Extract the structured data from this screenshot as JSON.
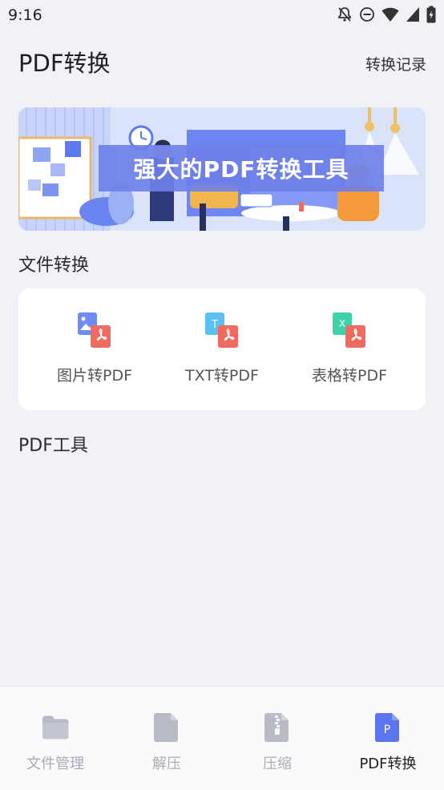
{
  "status_bar": {
    "time": "9:16",
    "icons": [
      "notifications-off-icon",
      "do-not-disturb-icon",
      "wifi-icon",
      "signal-icon",
      "battery-icon"
    ]
  },
  "header": {
    "title": "PDF转换",
    "action_label": "转换记录"
  },
  "banner": {
    "text": "强大的PDF转换工具"
  },
  "file_conversion": {
    "section_title": "文件转换",
    "tools": [
      {
        "label": "图片转PDF",
        "icon": "image-to-pdf-icon",
        "badge_color": "#6f8cf2"
      },
      {
        "label": "TXT转PDF",
        "icon": "txt-to-pdf-icon",
        "badge_color": "#5cc0f2"
      },
      {
        "label": "表格转PDF",
        "icon": "excel-to-pdf-icon",
        "badge_color": "#3fd1a8"
      }
    ]
  },
  "pdf_tools": {
    "section_title": "PDF工具"
  },
  "tabbar": {
    "items": [
      {
        "label": "文件管理",
        "icon": "folder-icon",
        "active": false
      },
      {
        "label": "解压",
        "icon": "document-icon",
        "active": false
      },
      {
        "label": "压缩",
        "icon": "zip-file-icon",
        "active": false
      },
      {
        "label": "PDF转换",
        "icon": "pdf-file-icon",
        "active": true
      }
    ]
  },
  "colors": {
    "accent": "#5b74f0",
    "background": "#f1f2f8",
    "pdf_red": "#f06a5f",
    "tab_inactive": "#b8bac6"
  }
}
